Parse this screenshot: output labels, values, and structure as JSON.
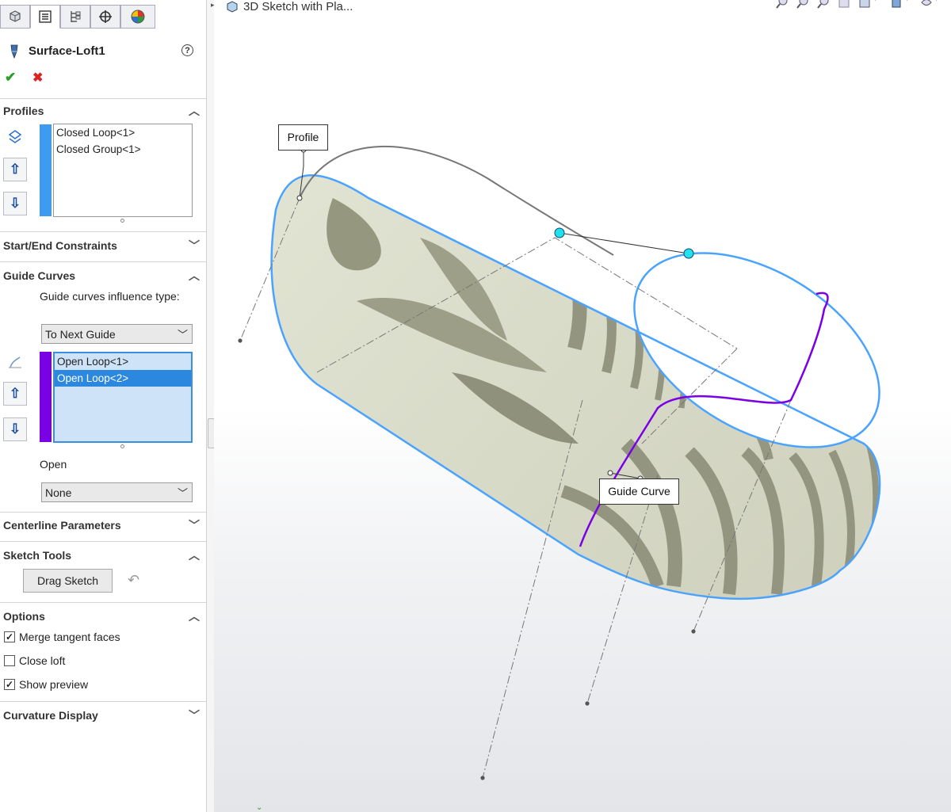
{
  "feature": {
    "title": "Surface-Loft1"
  },
  "tabs": [
    "feature-manager",
    "property-manager",
    "configuration-manager",
    "dimxpert-manager",
    "display-manager"
  ],
  "profiles": {
    "header": "Profiles",
    "items": [
      "Closed Loop<1>",
      "Closed Group<1>"
    ],
    "bar_color": "#3d9cf0"
  },
  "start_end": {
    "header": "Start/End Constraints"
  },
  "guide_curves": {
    "header": "Guide Curves",
    "influence_label": "Guide curves influence type:",
    "influence_value": "To Next Guide",
    "items": [
      "Open Loop<1>",
      "Open Loop<2>"
    ],
    "selected_index": 1,
    "bar_color": "#7a00e6",
    "open_label": "Open",
    "open_value": "None"
  },
  "centerline": {
    "header": "Centerline Parameters"
  },
  "sketch_tools": {
    "header": "Sketch Tools",
    "drag_label": "Drag Sketch"
  },
  "options": {
    "header": "Options",
    "merge_label": "Merge tangent faces",
    "merge_checked": true,
    "close_label": "Close loft",
    "close_checked": false,
    "preview_label": "Show preview",
    "preview_checked": true
  },
  "curvature": {
    "header": "Curvature Display"
  },
  "viewport": {
    "breadcrumb": "3D Sketch with Pla...",
    "callout_profile": "Profile",
    "callout_guide": "Guide Curve"
  },
  "colors": {
    "accent_blue": "#3b8fe0",
    "guide_purple": "#7a00e6",
    "edge_blue": "#4aa3ff",
    "zebra_light": "#d9dcc9",
    "zebra_dark": "#8d8f7c",
    "point_cyan": "#21e2ea"
  }
}
